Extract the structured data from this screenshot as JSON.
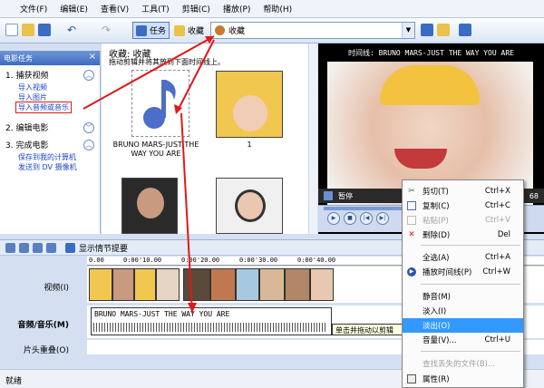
{
  "menu": [
    "文件(F)",
    "编辑(E)",
    "查看(V)",
    "工具(T)",
    "剪辑(C)",
    "播放(P)",
    "帮助(H)"
  ],
  "toolbar": {
    "tasks_label": "任务",
    "collections_label": "收藏",
    "combo_value": "收藏"
  },
  "taskpane": {
    "title": "电影任务",
    "s1": "1. 捕获视频",
    "s1_links": [
      "导入视频",
      "导入图片",
      "导入音频或音乐"
    ],
    "s2": "2. 编辑电影",
    "s3": "3. 完成电影",
    "s3_links": [
      "保存到我的计算机",
      "发送到 DV 摄像机"
    ]
  },
  "collection": {
    "title": "收藏: 收藏",
    "subtitle": "拖动剪辑并将其放到下面时间线上。",
    "items": [
      {
        "caption": "BRUNO MARS-JUST THE WAY YOU ARE"
      },
      {
        "caption": "1"
      }
    ]
  },
  "preview": {
    "title": "时间线: BRUNO MARS-JUST THE WAY YOU ARE",
    "status": "暂停",
    "counter": "68"
  },
  "timeline": {
    "toolbar_label": "显示情节提要",
    "ticks": [
      "0.00",
      "0:00'10.00",
      "0:00'20.00",
      "0:00'30.00",
      "0:00'40.00"
    ],
    "video_label": "视频(I)",
    "audio_label": "音频/音乐(M)",
    "title_label": "片头重叠(O)",
    "audio_clip": "BRUNO MARS-JUST THE WAY YOU ARE",
    "tooltip": "单击并拖动以剪辑"
  },
  "statusbar": "就绪",
  "context_menu": [
    {
      "icon": "scissors-icon",
      "label": "剪切(T)",
      "shortcut": "Ctrl+X"
    },
    {
      "icon": "copy-icon",
      "label": "复制(C)",
      "shortcut": "Ctrl+C"
    },
    {
      "icon": "paste-icon",
      "label": "粘贴(P)",
      "shortcut": "Ctrl+V",
      "disabled": true
    },
    {
      "icon": "delete-icon",
      "label": "删除(D)",
      "shortcut": "Del"
    },
    {
      "label": "全选(A)",
      "shortcut": "Ctrl+A"
    },
    {
      "icon": "play-icon",
      "label": "播放时间线(P)",
      "shortcut": "Ctrl+W"
    },
    {
      "label": "静音(M)"
    },
    {
      "label": "淡入(I)"
    },
    {
      "label": "淡出(O)",
      "highlighted": true
    },
    {
      "label": "音量(V)...",
      "shortcut": "Ctrl+U"
    },
    {
      "label": "查找丢失的文件(B)...",
      "disabled": true
    },
    {
      "icon": "properties-icon",
      "label": "属性(R)"
    }
  ],
  "colors": {
    "highlight": "#3399ff",
    "accent_red": "#e01818",
    "pane_blue": "#3e6bc0"
  }
}
